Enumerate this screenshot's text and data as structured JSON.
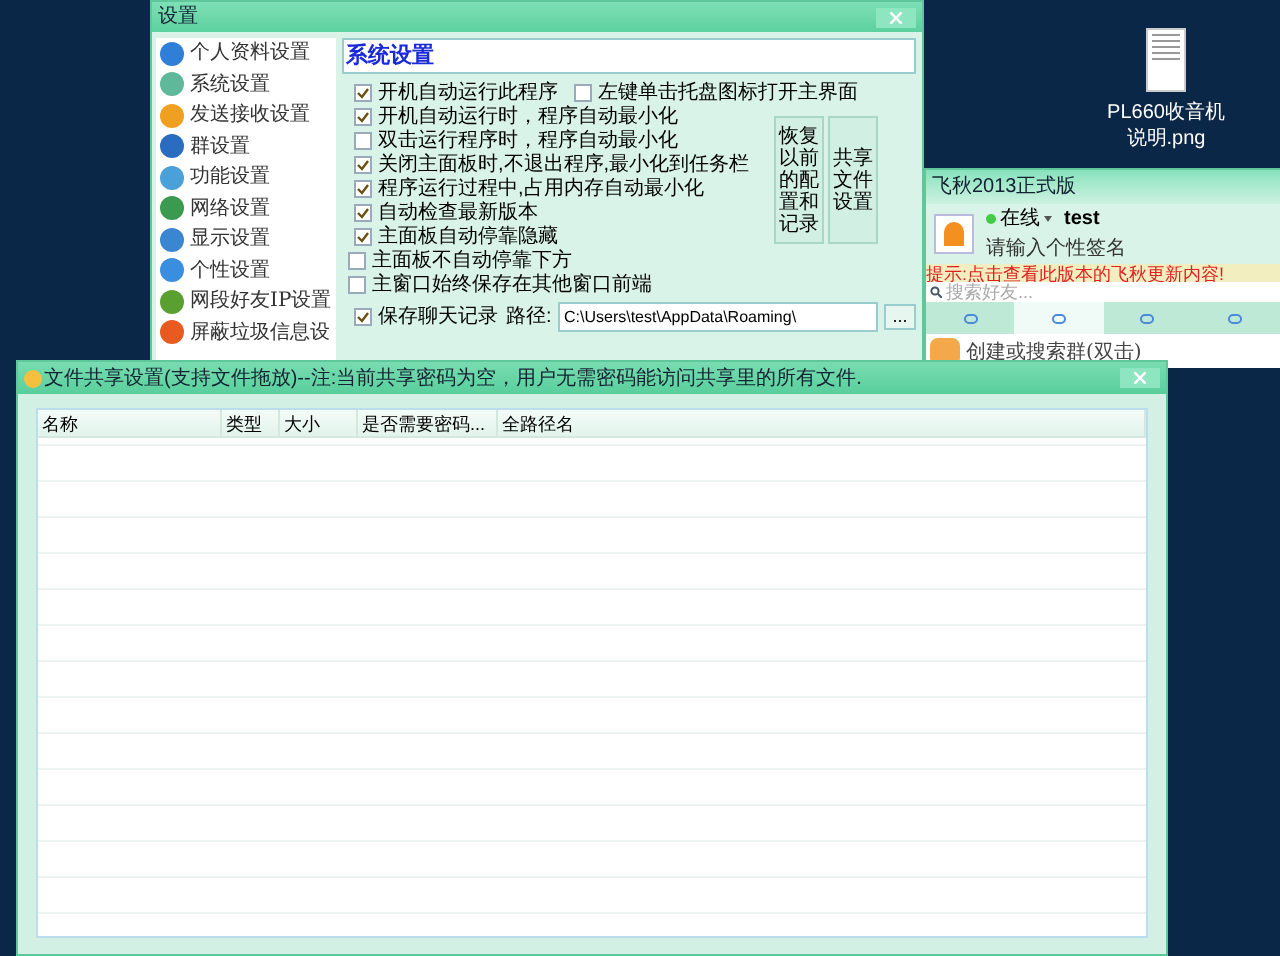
{
  "desktop_icon": {
    "label": "PL660收音机说明.png"
  },
  "settings_window": {
    "title": "设置",
    "sidebar": {
      "items": [
        {
          "label": "个人资料设置",
          "color": "#2f7fd8"
        },
        {
          "label": "系统设置",
          "color": "#5fb89a"
        },
        {
          "label": "发送接收设置",
          "color": "#f0a020"
        },
        {
          "label": "群设置",
          "color": "#2a6cc0"
        },
        {
          "label": "功能设置",
          "color": "#4aa0d8"
        },
        {
          "label": "网络设置",
          "color": "#3a9a50"
        },
        {
          "label": "显示设置",
          "color": "#3a86d0"
        },
        {
          "label": "个性设置",
          "color": "#3a8ee0"
        },
        {
          "label": "网段好友IP设置",
          "color": "#5aa030"
        },
        {
          "label": "屏蔽垃圾信息设",
          "color": "#e85a20"
        }
      ]
    },
    "heading": "系统设置",
    "options": [
      {
        "label": "开机自动运行此程序",
        "checked": true
      },
      {
        "label": "左键单击托盘图标打开主界面",
        "checked": false
      },
      {
        "label": "开机自动运行时，程序自动最小化",
        "checked": true
      },
      {
        "label": "双击运行程序时，程序自动最小化",
        "checked": false
      },
      {
        "label": "关闭主面板时,不退出程序,最小化到任务栏",
        "checked": true
      },
      {
        "label": "程序运行过程中,占用内存自动最小化",
        "checked": true
      },
      {
        "label": "自动检查最新版本",
        "checked": true
      },
      {
        "label": "主面板自动停靠隐藏",
        "checked": true
      },
      {
        "label": "主面板不自动停靠下方",
        "checked": false
      },
      {
        "label": "主窗口始终保存在其他窗口前端",
        "checked": false
      }
    ],
    "side_buttons": [
      "恢复以前的配置和记录",
      "共享文件设置"
    ],
    "save_chat": {
      "label": "保存聊天记录",
      "checked": true,
      "path_label": "路径:",
      "path_value": "C:\\Users\\test\\AppData\\Roaming\\",
      "browse": "..."
    }
  },
  "feiq_window": {
    "title": "飞秋2013正式版",
    "status": "在线",
    "username": "test",
    "signature": "请输入个性签名",
    "notice": "提示:点击查看此版本的飞秋更新内容!",
    "search_placeholder": "搜索好友...",
    "tabs": [
      {
        "selected": false
      },
      {
        "selected": true
      },
      {
        "selected": false
      },
      {
        "selected": false
      }
    ],
    "list_item": "创建或搜索群(双击)"
  },
  "share_window": {
    "title": "文件共享设置(支持文件拖放)--注:当前共享密码为空，用户无需密码能访问共享里的所有文件.",
    "columns": [
      "名称",
      "类型",
      "大小",
      "是否需要密码...",
      "全路径名"
    ]
  }
}
